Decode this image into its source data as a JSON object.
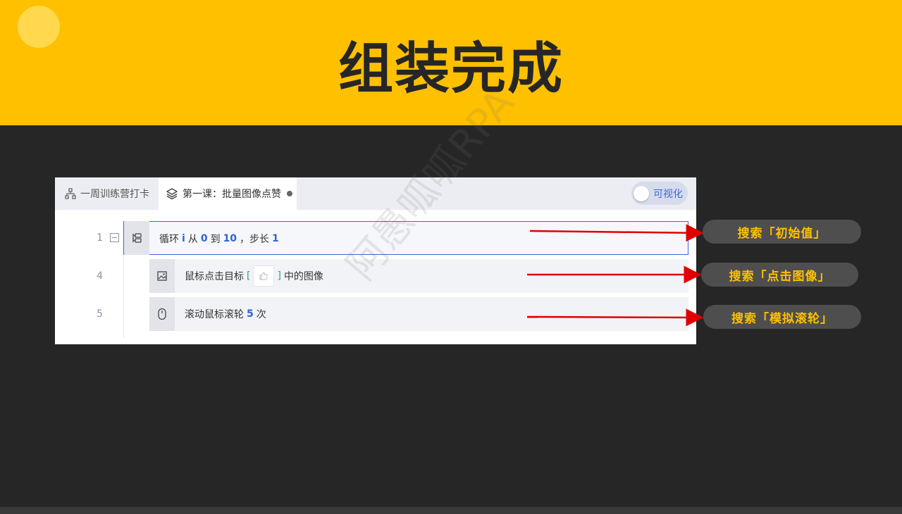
{
  "slide": {
    "title": "组装完成",
    "watermark": "阿愚呱呱RPA"
  },
  "tabs": [
    {
      "label": "一周训练营打卡",
      "icon": "sitemap-icon"
    },
    {
      "label": "第一课：批量图像点赞",
      "icon": "layers-icon",
      "modified": true
    }
  ],
  "toggle": {
    "label": "可视化",
    "on": false
  },
  "rows": [
    {
      "line": "1",
      "icon": "loop-icon",
      "parts": {
        "t1": "循环",
        "var": "i",
        "t2": "从",
        "from": "0",
        "t3": "到",
        "to": "10",
        "t4": "，步长",
        "step": "1"
      }
    },
    {
      "line": "4",
      "icon": "image-icon",
      "parts": {
        "t1": "鼠标点击目标",
        "open": "[",
        "close": "]",
        "t2": "中的图像"
      }
    },
    {
      "line": "5",
      "icon": "mouse-icon",
      "parts": {
        "t1": "滚动鼠标滚轮",
        "count": "5",
        "t2": "次"
      }
    }
  ],
  "callouts": [
    {
      "label": "搜索「初始值」"
    },
    {
      "label": "搜索「点击图像」"
    },
    {
      "label": "搜索「模拟滚轮」"
    }
  ],
  "colors": {
    "banner": "#FFC000",
    "background": "#262626",
    "accent": "#2D62D8",
    "arrow": "#E00000",
    "callout_text": "#FFC000"
  }
}
